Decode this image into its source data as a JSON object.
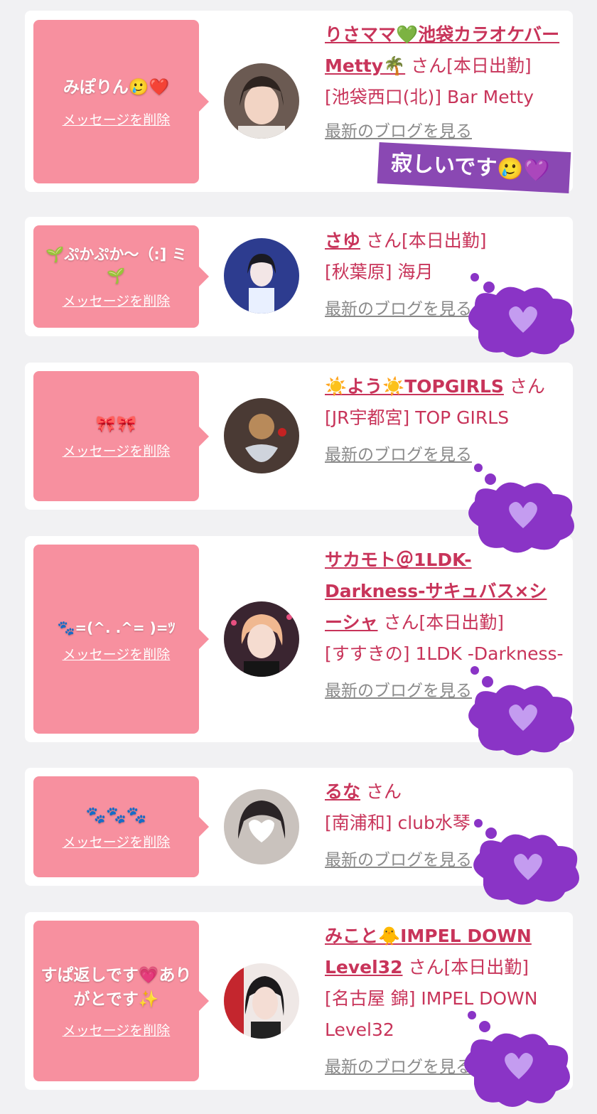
{
  "common": {
    "delete_label": "メッセージを削除",
    "san": "さん",
    "blog_label": "最新のブログを見る"
  },
  "items": [
    {
      "message": "みぽりん🥲❤️",
      "name": "りさママ💚池袋カラオケバーMetty🌴",
      "status": "[本日出勤]",
      "shop": "[池袋西口(北)] Bar Metty"
    },
    {
      "message": "🌱ぷかぷか～（:] ミ🌱",
      "name": "さゆ",
      "status": "[本日出勤]",
      "shop": "[秋葉原] 海月"
    },
    {
      "message": "🎀🎀",
      "name": "☀️よう☀️TOPGIRLS",
      "status": "",
      "shop": "[JR宇都宮] TOP GIRLS"
    },
    {
      "message": "🐾=(^. .^= )=ﾂ",
      "name": "サカモト＠1LDK-Darkness-サキュバス×シーシャ",
      "status": "[本日出勤]",
      "shop": "[すすきの] 1LDK -Darkness-"
    },
    {
      "message": "🐾🐾🐾",
      "name": "るな",
      "status": "",
      "shop": "[南浦和] club水琴"
    },
    {
      "message": "すぱ返しです💗ありがとです✨",
      "name": "みこと🐥IMPEL DOWN Level32",
      "status": "[本日出勤]",
      "shop": "[名古屋 錦] IMPEL DOWN Level32"
    }
  ],
  "sticker": {
    "text": "寂しいです🥲💜"
  },
  "cloud_icon": "purple-heart-icon",
  "colors": {
    "bubble": "#f7909f",
    "accent": "#c8345a",
    "cloud": "#8a34c6",
    "heart": "#c49cf0"
  }
}
